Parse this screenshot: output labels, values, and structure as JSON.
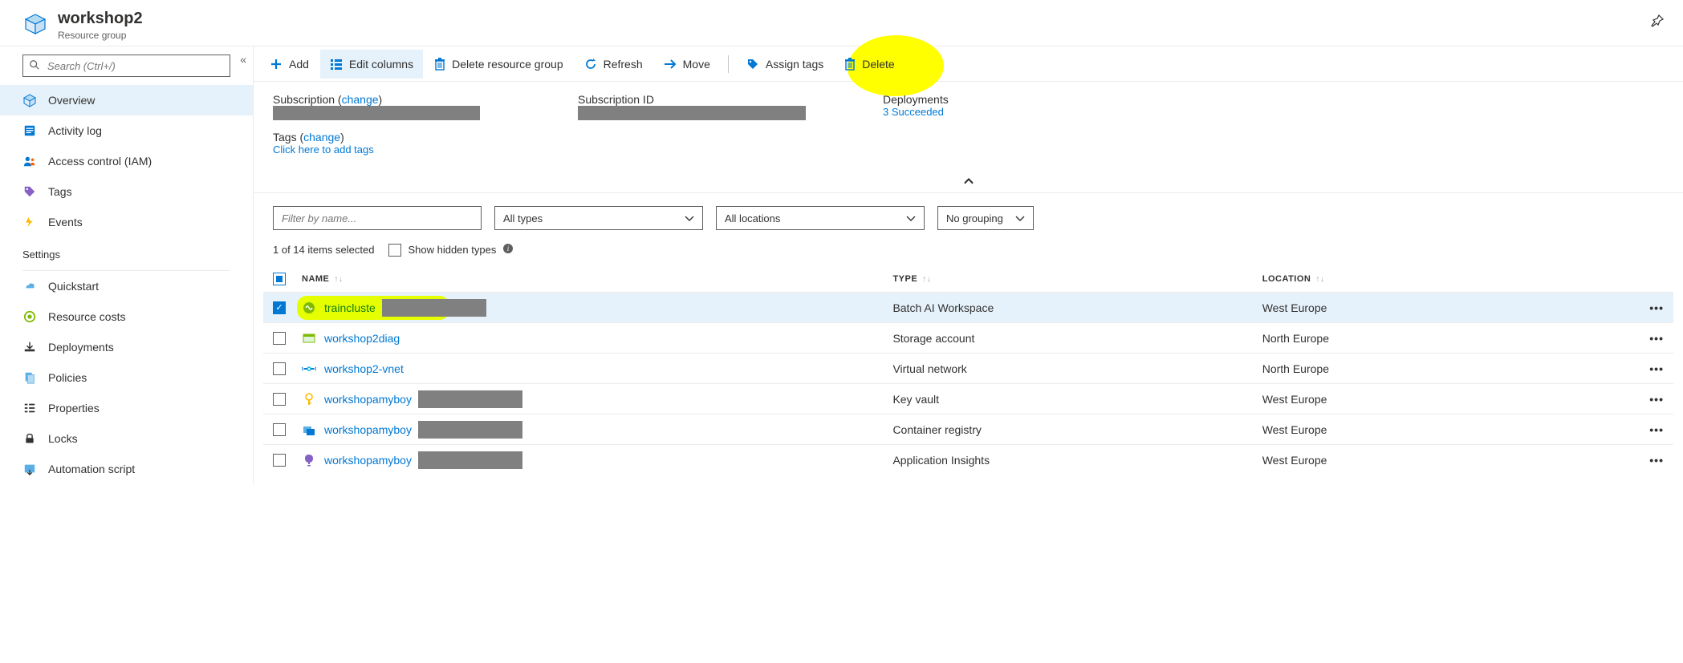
{
  "header": {
    "title": "workshop2",
    "subtitle": "Resource group"
  },
  "sidebar": {
    "search_placeholder": "Search (Ctrl+/)",
    "items": [
      {
        "label": "Overview"
      },
      {
        "label": "Activity log"
      },
      {
        "label": "Access control (IAM)"
      },
      {
        "label": "Tags"
      },
      {
        "label": "Events"
      }
    ],
    "settings_heading": "Settings",
    "settings": [
      {
        "label": "Quickstart"
      },
      {
        "label": "Resource costs"
      },
      {
        "label": "Deployments"
      },
      {
        "label": "Policies"
      },
      {
        "label": "Properties"
      },
      {
        "label": "Locks"
      },
      {
        "label": "Automation script"
      }
    ]
  },
  "toolbar": {
    "add": "Add",
    "edit_columns": "Edit columns",
    "delete_rg": "Delete resource group",
    "refresh": "Refresh",
    "move": "Move",
    "assign_tags": "Assign tags",
    "delete": "Delete"
  },
  "essentials": {
    "subscription_label": "Subscription (",
    "subscription_change": "change",
    "close_paren": ")",
    "subscription_id_label": "Subscription ID",
    "deployments_label": "Deployments",
    "deployments_value": "3 Succeeded",
    "tags_label": "Tags (",
    "tags_change": "change",
    "tags_add_link": "Click here to add tags"
  },
  "filters": {
    "name_placeholder": "Filter by name...",
    "types": "All types",
    "locations": "All locations",
    "grouping": "No grouping"
  },
  "status_row": {
    "selected_text": "1 of 14 items selected",
    "show_hidden_label": "Show hidden types"
  },
  "table": {
    "headers": {
      "name": "Name",
      "type": "Type",
      "location": "Location"
    },
    "rows": [
      {
        "name": "traincluste",
        "type": "Batch AI Workspace",
        "location": "West Europe",
        "selected": true,
        "redacted": true,
        "highlight": true
      },
      {
        "name": "workshop2diag",
        "type": "Storage account",
        "location": "North Europe",
        "selected": false,
        "redacted": false
      },
      {
        "name": "workshop2-vnet",
        "type": "Virtual network",
        "location": "North Europe",
        "selected": false,
        "redacted": false
      },
      {
        "name": "workshopamyboy",
        "type": "Key vault",
        "location": "West Europe",
        "selected": false,
        "redacted": true
      },
      {
        "name": "workshopamyboy",
        "type": "Container registry",
        "location": "West Europe",
        "selected": false,
        "redacted": true
      },
      {
        "name": "workshopamyboy",
        "type": "Application Insights",
        "location": "West Europe",
        "selected": false,
        "redacted": true
      }
    ]
  }
}
